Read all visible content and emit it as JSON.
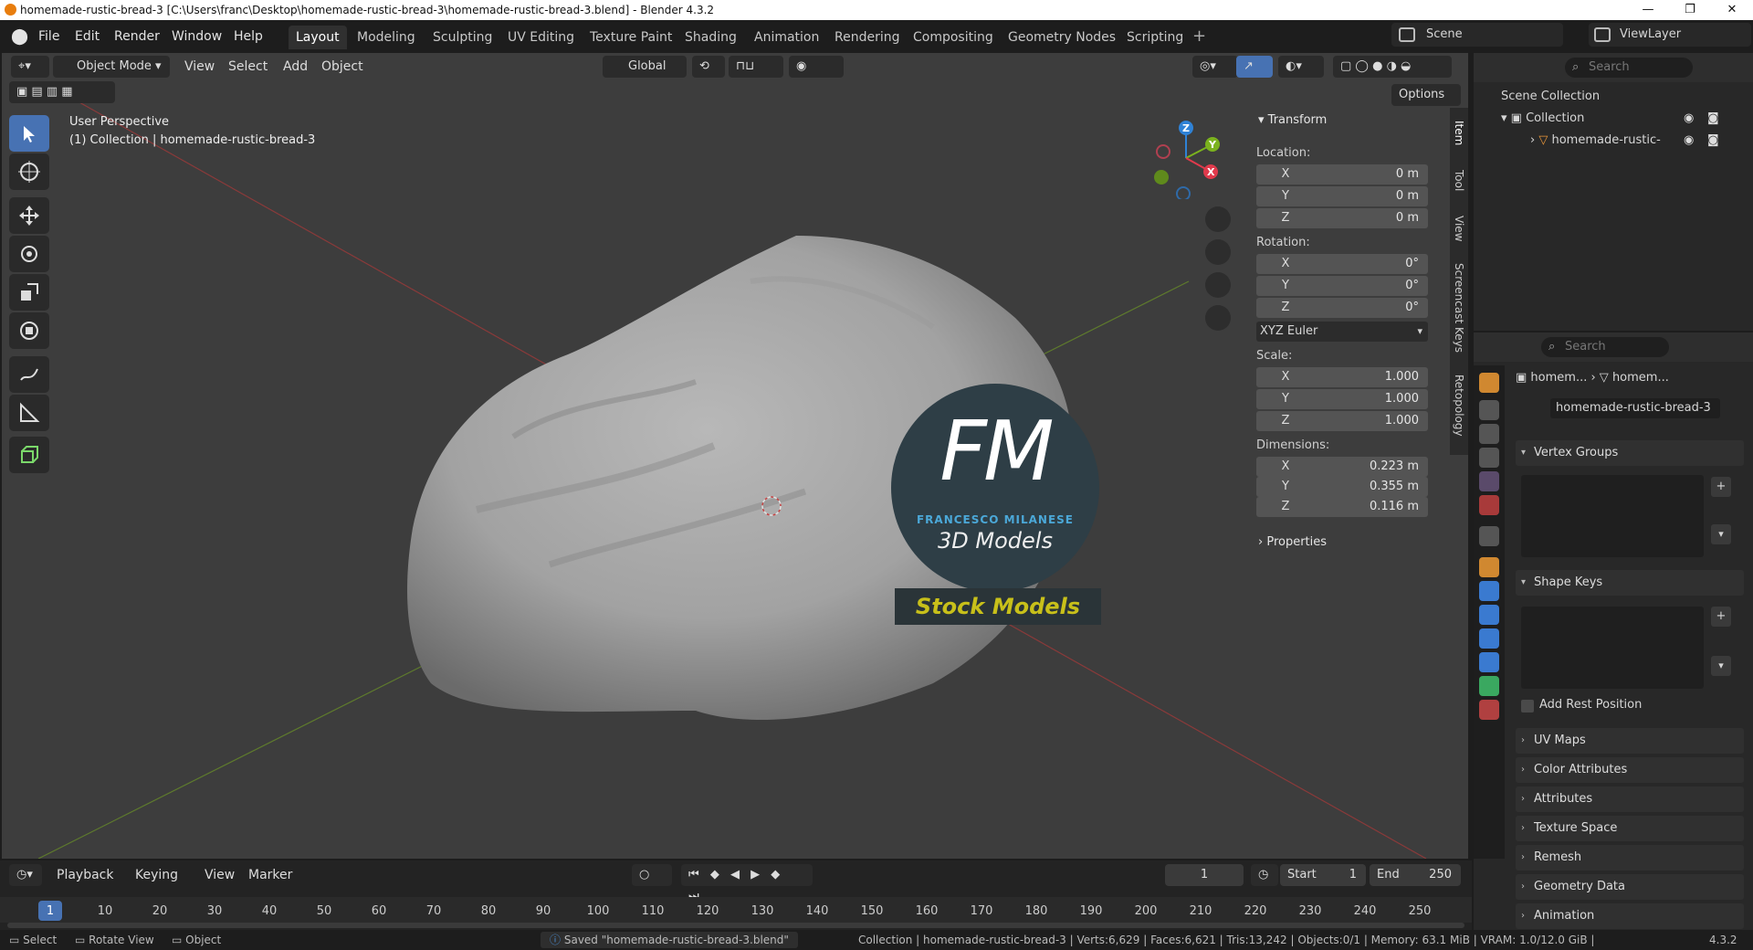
{
  "window": {
    "title": "homemade-rustic-bread-3 [C:\\Users\\franc\\Desktop\\homemade-rustic-bread-3\\homemade-rustic-bread-3.blend] - Blender 4.3.2",
    "controls": [
      "—",
      "❐",
      "✕"
    ]
  },
  "menu": {
    "items": [
      "File",
      "Edit",
      "Render",
      "Window",
      "Help"
    ],
    "workspaces": [
      "Layout",
      "Modeling",
      "Sculpting",
      "UV Editing",
      "Texture Paint",
      "Shading",
      "Animation",
      "Rendering",
      "Compositing",
      "Geometry Nodes",
      "Scripting"
    ],
    "active_workspace": "Layout",
    "scene": "Scene",
    "view_layer": "ViewLayer"
  },
  "viewport_header": {
    "mode": "Object Mode",
    "menus": [
      "View",
      "Select",
      "Add",
      "Object"
    ],
    "orientation": "Global",
    "options": "Options"
  },
  "viewport": {
    "perspective": "User Perspective",
    "collection_info": "(1) Collection | homemade-rustic-bread-3",
    "watermark": {
      "monogram": "FM",
      "author": "FRANCESCO MILANESE",
      "subtitle": "3D Models",
      "banner": "Stock Models"
    },
    "gizmo": {
      "z": "Z",
      "y": "Y",
      "x": "X"
    }
  },
  "npanel": {
    "section": "Transform",
    "location_label": "Location:",
    "location": [
      {
        "axis": "X",
        "value": "0 m"
      },
      {
        "axis": "Y",
        "value": "0 m"
      },
      {
        "axis": "Z",
        "value": "0 m"
      }
    ],
    "rotation_label": "Rotation:",
    "rotation": [
      {
        "axis": "X",
        "value": "0°"
      },
      {
        "axis": "Y",
        "value": "0°"
      },
      {
        "axis": "Z",
        "value": "0°"
      }
    ],
    "rotation_mode": "XYZ Euler",
    "scale_label": "Scale:",
    "scale": [
      {
        "axis": "X",
        "value": "1.000"
      },
      {
        "axis": "Y",
        "value": "1.000"
      },
      {
        "axis": "Z",
        "value": "1.000"
      }
    ],
    "dimensions_label": "Dimensions:",
    "dimensions": [
      {
        "axis": "X",
        "value": "0.223 m"
      },
      {
        "axis": "Y",
        "value": "0.355 m"
      },
      {
        "axis": "Z",
        "value": "0.116 m"
      }
    ],
    "properties": "Properties",
    "tabs": [
      "Item",
      "Tool",
      "View",
      "Screencast Keys",
      "Retopology"
    ]
  },
  "outliner": {
    "search_placeholder": "Search",
    "scene_collection": "Scene Collection",
    "collection": "Collection",
    "object": "homemade-rustic-"
  },
  "properties": {
    "search_placeholder": "Search",
    "breadcrumb_1": "homem...",
    "breadcrumb_2": "homem...",
    "mesh_name": "homemade-rustic-bread-3",
    "sections": [
      "Vertex Groups",
      "Shape Keys",
      "UV Maps",
      "Color Attributes",
      "Attributes",
      "Texture Space",
      "Remesh",
      "Geometry Data",
      "Animation"
    ],
    "add_rest_position": "Add Rest Position"
  },
  "timeline": {
    "menus": [
      "Playback",
      "Keying",
      "View",
      "Marker"
    ],
    "current_frame": "1",
    "start_label": "Start",
    "start": "1",
    "end_label": "End",
    "end": "250",
    "ruler": [
      "1",
      "10",
      "20",
      "30",
      "40",
      "50",
      "60",
      "70",
      "80",
      "90",
      "100",
      "110",
      "120",
      "130",
      "140",
      "150",
      "160",
      "170",
      "180",
      "190",
      "200",
      "210",
      "220",
      "230",
      "240",
      "250"
    ]
  },
  "status": {
    "hints": [
      "Select",
      "Rotate View",
      "Object"
    ],
    "message": "Saved \"homemade-rustic-bread-3.blend\"",
    "stats": "Collection | homemade-rustic-bread-3 | Verts:6,629 | Faces:6,621 | Tris:13,242 | Objects:0/1 | Memory: 63.1 MiB | VRAM: 1.0/12.0 GiB |",
    "version": "4.3.2"
  }
}
